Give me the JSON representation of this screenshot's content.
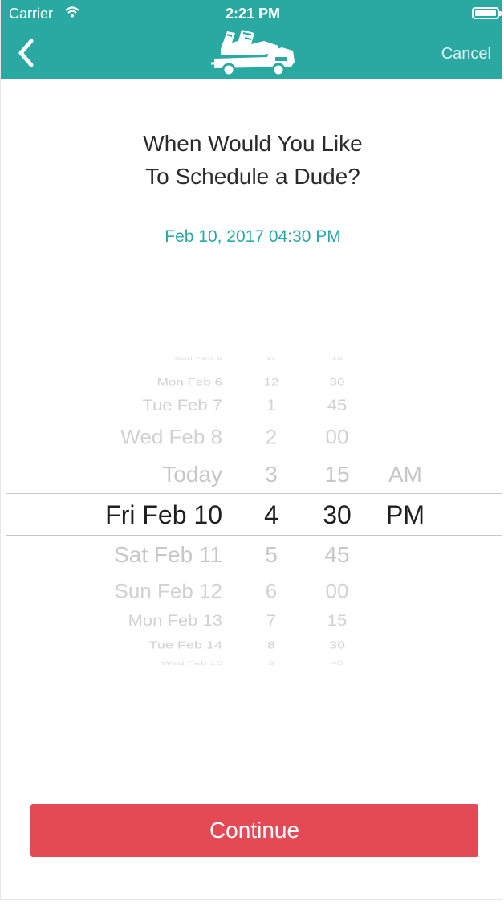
{
  "status_bar": {
    "carrier": "Carrier",
    "time": "2:21 PM"
  },
  "nav": {
    "cancel_label": "Cancel",
    "logo_icon": "truck-logo-icon",
    "back_icon": "chevron-left-icon"
  },
  "heading": {
    "line1": "When Would You Like",
    "line2": "To Schedule a Dude?"
  },
  "selected_datetime": "Feb 10, 2017 04:30 PM",
  "picker": {
    "rows": [
      {
        "date": "Sun Feb 5",
        "hour": "11",
        "minute": "15",
        "ampm": ""
      },
      {
        "date": "Mon Feb 6",
        "hour": "12",
        "minute": "30",
        "ampm": ""
      },
      {
        "date": "Tue Feb 7",
        "hour": "1",
        "minute": "45",
        "ampm": ""
      },
      {
        "date": "Wed Feb 8",
        "hour": "2",
        "minute": "00",
        "ampm": ""
      },
      {
        "date": "Today",
        "hour": "3",
        "minute": "15",
        "ampm": "AM"
      },
      {
        "date": "Fri Feb 10",
        "hour": "4",
        "minute": "30",
        "ampm": "PM"
      },
      {
        "date": "Sat Feb 11",
        "hour": "5",
        "minute": "45",
        "ampm": ""
      },
      {
        "date": "Sun Feb 12",
        "hour": "6",
        "minute": "00",
        "ampm": ""
      },
      {
        "date": "Mon Feb 13",
        "hour": "7",
        "minute": "15",
        "ampm": ""
      },
      {
        "date": "Tue Feb 14",
        "hour": "8",
        "minute": "30",
        "ampm": ""
      },
      {
        "date": "Wed Feb 15",
        "hour": "9",
        "minute": "45",
        "ampm": ""
      }
    ],
    "selected_index": 5
  },
  "continue_label": "Continue",
  "colors": {
    "brand_teal": "#2aa9a3",
    "continue_red": "#e44a55"
  }
}
